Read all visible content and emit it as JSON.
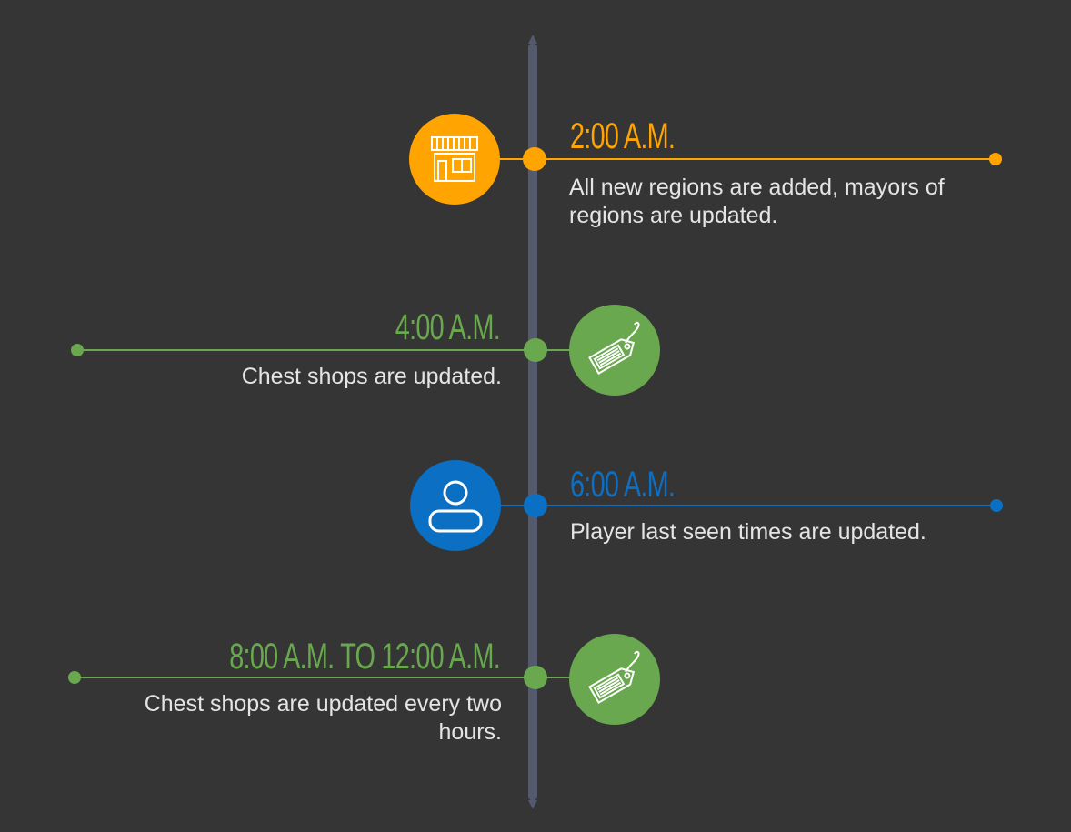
{
  "colors": {
    "background": "#353535",
    "spine": "#55596e",
    "orange": "#ffa400",
    "green": "#6aa84f",
    "blue": "#0b6fc3"
  },
  "events": [
    {
      "time": "2:00 A.M.",
      "description": "All new regions are added, mayors of regions are updated.",
      "icon": "shop-icon",
      "color": "orange",
      "side": "right"
    },
    {
      "time": "4:00 A.M.",
      "description": "Chest shops are updated.",
      "icon": "price-tag-icon",
      "color": "green",
      "side": "left"
    },
    {
      "time": "6:00 A.M.",
      "description": "Player last seen times are updated.",
      "icon": "user-icon",
      "color": "blue",
      "side": "right"
    },
    {
      "time": "8:00 A.M. TO 12:00 A.M.",
      "description": "Chest shops are updated every two hours.",
      "icon": "price-tag-icon",
      "color": "green",
      "side": "left"
    }
  ]
}
